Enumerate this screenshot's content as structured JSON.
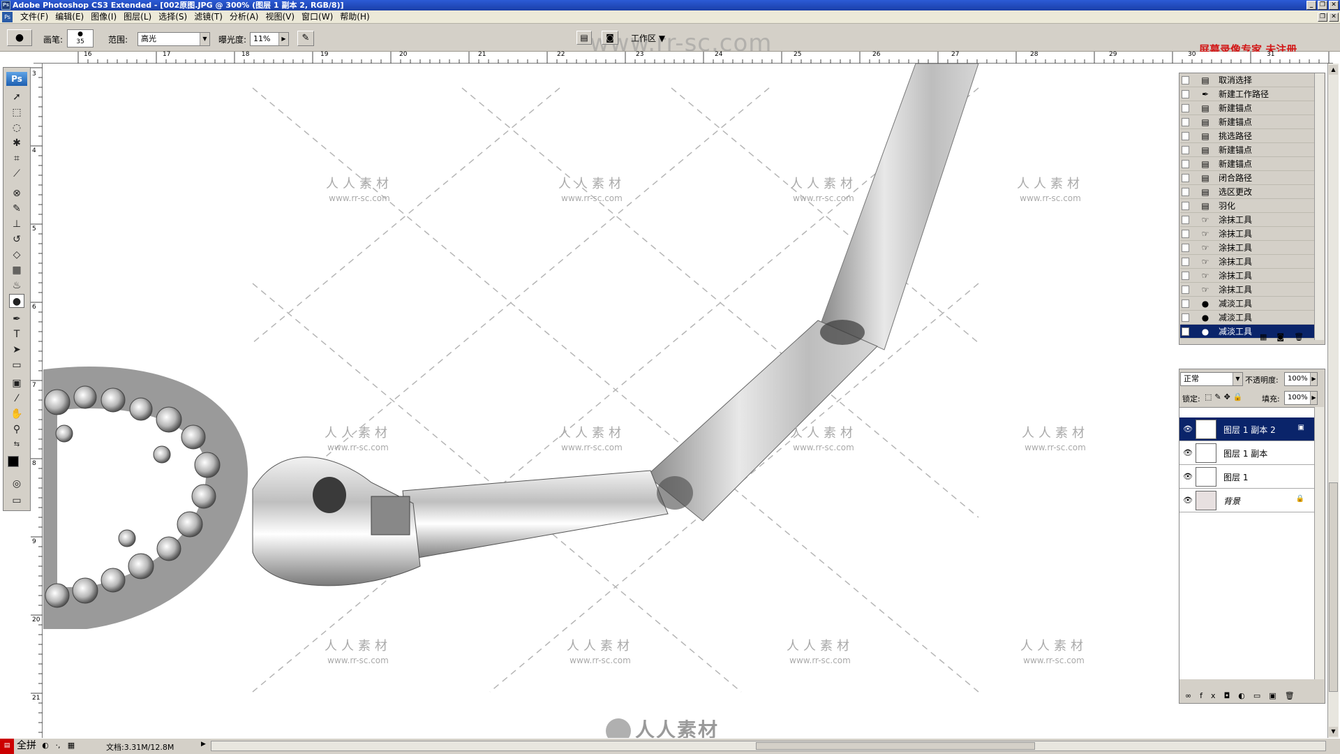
{
  "window": {
    "title": "Adobe Photoshop CS3 Extended - [002原图.JPG @ 300% (图层 1 副本 2, RGB/8)]",
    "top_watermark": "www.rr-sc.com",
    "recorder_notice": "屏幕录像专家 未注册"
  },
  "menu": {
    "items": [
      "文件(F)",
      "编辑(E)",
      "图像(I)",
      "图层(L)",
      "选择(S)",
      "滤镜(T)",
      "分析(A)",
      "视图(V)",
      "窗口(W)",
      "帮助(H)"
    ]
  },
  "options": {
    "brush_label": "画笔:",
    "brush_size": "35",
    "range_label": "范围:",
    "range_value": "高光",
    "exposure_label": "曝光度:",
    "exposure_value": "11%",
    "workspace_label": "工作区"
  },
  "ruler": {
    "h_ticks": [
      "16",
      "17",
      "18",
      "19",
      "20",
      "21",
      "22",
      "23",
      "24",
      "25",
      "26",
      "27",
      "28",
      "29",
      "30",
      "31"
    ],
    "v_ticks": [
      "3",
      "4",
      "5",
      "6",
      "7",
      "8",
      "9",
      "20",
      "21"
    ]
  },
  "toolbox": {
    "logo": "Ps"
  },
  "canvas": {
    "watermark_cn": "人人素材",
    "watermark_url": "www.rr-sc.com"
  },
  "history": {
    "items": [
      {
        "label": "取消选择",
        "icon": "document-icon"
      },
      {
        "label": "新建工作路径",
        "icon": "pen-icon"
      },
      {
        "label": "新建锚点",
        "icon": "document-icon"
      },
      {
        "label": "新建锚点",
        "icon": "document-icon"
      },
      {
        "label": "挑选路径",
        "icon": "document-icon"
      },
      {
        "label": "新建锚点",
        "icon": "document-icon"
      },
      {
        "label": "新建锚点",
        "icon": "document-icon"
      },
      {
        "label": "闭合路径",
        "icon": "document-icon"
      },
      {
        "label": "选区更改",
        "icon": "document-icon"
      },
      {
        "label": "羽化",
        "icon": "document-icon"
      },
      {
        "label": "涂抹工具",
        "icon": "smudge-icon"
      },
      {
        "label": "涂抹工具",
        "icon": "smudge-icon"
      },
      {
        "label": "涂抹工具",
        "icon": "smudge-icon"
      },
      {
        "label": "涂抹工具",
        "icon": "smudge-icon"
      },
      {
        "label": "涂抹工具",
        "icon": "smudge-icon"
      },
      {
        "label": "涂抹工具",
        "icon": "smudge-icon"
      },
      {
        "label": "减淡工具",
        "icon": "dodge-icon"
      },
      {
        "label": "减淡工具",
        "icon": "dodge-icon"
      },
      {
        "label": "减淡工具",
        "icon": "dodge-icon"
      }
    ]
  },
  "layers": {
    "blend_mode": "正常",
    "opacity_label": "不透明度:",
    "opacity_value": "100%",
    "lock_label": "锁定:",
    "fill_label": "填充:",
    "fill_value": "100%",
    "items": [
      {
        "name": "图层 1 副本 2",
        "selected": true
      },
      {
        "name": "图层 1 副本",
        "selected": false
      },
      {
        "name": "图层 1",
        "selected": false
      },
      {
        "name": "背景",
        "selected": false
      }
    ]
  },
  "status": {
    "taskbar_label": "全拼",
    "doc_info": "文档:3.31M/12.8M"
  },
  "bottom_logo": "人人素材"
}
